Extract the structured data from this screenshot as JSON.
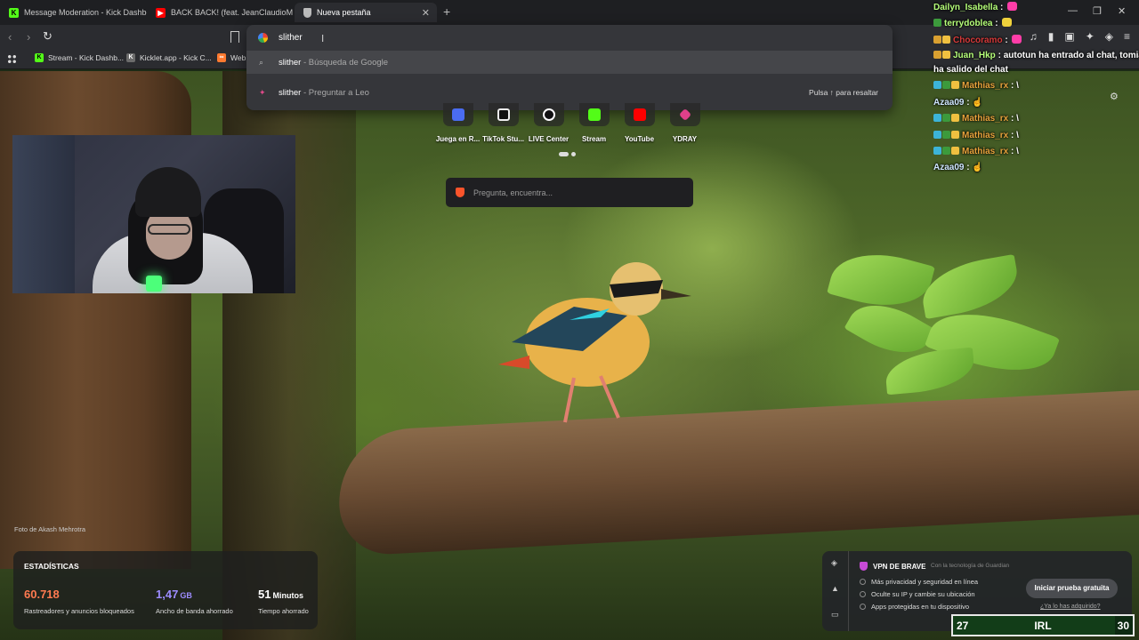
{
  "tabs": [
    {
      "title": "Message Moderation - Kick Dashboa",
      "icon": "kick-icon"
    },
    {
      "title": "BACK BACK! (feat. JeanClaudioM",
      "icon": "youtube-icon"
    },
    {
      "title": "Nueva pestaña",
      "icon": "shield-icon",
      "active": true
    }
  ],
  "bookmarks": [
    {
      "label": "Stream - Kick Dashb...",
      "icon": "kick-icon"
    },
    {
      "label": "Kicklet.app - Kick C...",
      "icon": "kicklet-icon"
    },
    {
      "label": "Web",
      "icon": "web-icon"
    }
  ],
  "omnibox": {
    "value": "slither",
    "suggestions": [
      {
        "strong": "slither",
        "rest": " - Búsqueda de Google",
        "icon": "search-icon"
      },
      {
        "strong": "slither",
        "rest": " - Preguntar a Leo",
        "icon": "leo-icon",
        "hint": "Pulsa ↑ para resaltar"
      }
    ]
  },
  "shortcuts": [
    {
      "label": "Juega en R...",
      "color": "#4a6cf0"
    },
    {
      "label": "TikTok Stu...",
      "color": "#111111"
    },
    {
      "label": "LIVE Center",
      "color": "#111111"
    },
    {
      "label": "Stream",
      "color": "#53fc18"
    },
    {
      "label": "YouTube",
      "color": "#ff0000"
    },
    {
      "label": "YDRAY",
      "color": "#e0408a"
    }
  ],
  "search": {
    "placeholder": "Pregunta, encuentra..."
  },
  "photo_credit": "Foto de Akash Mehrotra",
  "stats": {
    "title": "ESTADÍSTICAS",
    "items": [
      {
        "value": "60.718",
        "unit": "",
        "label": "Rastreadores y anuncios bloqueados",
        "color": "#ff7a50"
      },
      {
        "value": "1,47",
        "unit": "GB",
        "label": "Ancho de banda ahorrado",
        "color": "#9d8cff"
      },
      {
        "value": "51",
        "unit": "Minutos",
        "label": "Tiempo ahorrado",
        "color": "#ffffff"
      }
    ]
  },
  "vpn": {
    "title": "VPN DE BRAVE",
    "by": "Con la tecnología de Guardian",
    "items": [
      "Más privacidad y seguridad en línea",
      "Oculte su IP y cambie su ubicación",
      "Apps protegidas en tu dispositivo"
    ],
    "button": "Iniciar prueba gratuita",
    "link": "¿Ya lo has adquirido?"
  },
  "chat": [
    {
      "user": "Dailyn_Isabella",
      "color": "#b6ff7a",
      "text": "",
      "emote": "#ff3da8"
    },
    {
      "user": "terrydoblea",
      "color": "#b6ff7a",
      "text": "",
      "emote": "#f0d23c",
      "badges": [
        "#3c9a3c"
      ]
    },
    {
      "user": "Chocoramo",
      "color": "#d63a3a",
      "text": "",
      "emote": "#ff3da8",
      "badges": [
        "#d9a030",
        "#f0c040"
      ]
    },
    {
      "user": "Juan_Hkp",
      "color": "#b6ff7a",
      "text": "autotun ha entrado al chat, tomia",
      "badges": [
        "#d9a030",
        "#f0c040"
      ]
    },
    {
      "user": "",
      "color": "#ffffff",
      "text": "ha salido del chat"
    },
    {
      "user": "Mathias_rx",
      "color": "#e8a33c",
      "text": "\\",
      "badges": [
        "#3cb4d8",
        "#3c9a3c",
        "#f0c040"
      ]
    },
    {
      "user": "Azaa09",
      "color": "#cfe6ff",
      "text": "☝"
    },
    {
      "user": "Mathias_rx",
      "color": "#e8a33c",
      "text": "\\",
      "badges": [
        "#3cb4d8",
        "#3c9a3c",
        "#f0c040"
      ]
    },
    {
      "user": "Mathias_rx",
      "color": "#e8a33c",
      "text": "\\",
      "badges": [
        "#3cb4d8",
        "#3c9a3c",
        "#f0c040"
      ]
    },
    {
      "user": "Mathias_rx",
      "color": "#e8a33c",
      "text": "\\",
      "badges": [
        "#3cb4d8",
        "#3c9a3c",
        "#f0c040"
      ]
    },
    {
      "user": "Azaa09",
      "color": "#cfe6ff",
      "text": "☝"
    }
  ],
  "irl": {
    "left": "27",
    "center": "IRL",
    "right": "30",
    "progress": 0.9
  }
}
